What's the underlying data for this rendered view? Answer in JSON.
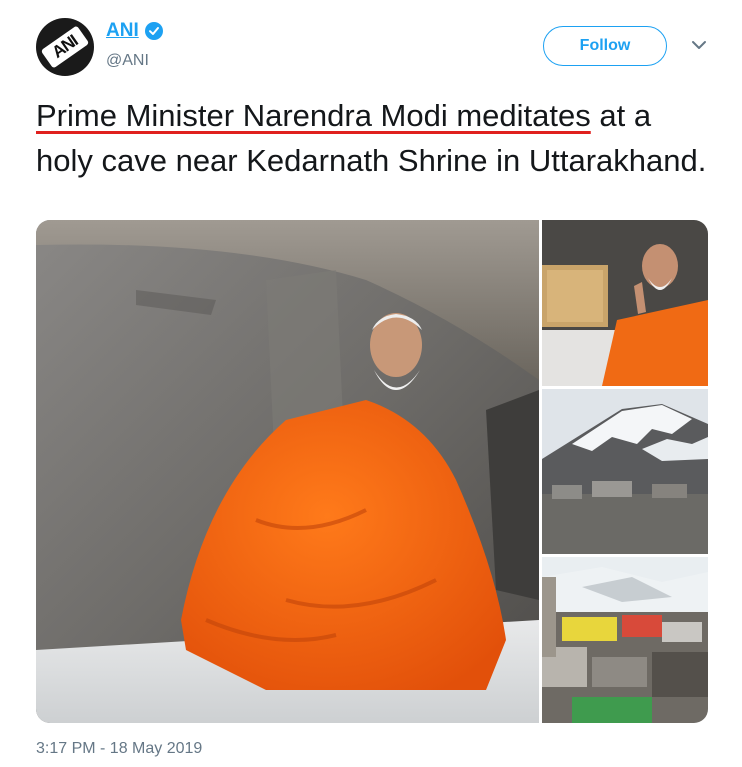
{
  "account": {
    "display_name": "ANI",
    "handle": "@ANI",
    "avatar_text": "ANI",
    "verified": true
  },
  "follow_label": "Follow",
  "tweet": {
    "text_highlighted": "Prime Minister Narendra Modi meditates",
    "text_rest": " at a holy cave near Kedarnath Shrine in Uttarakhand."
  },
  "timestamp": "3:17 PM - 18 May 2019",
  "colors": {
    "accent": "#1da1f2",
    "underline": "#e0201e",
    "text": "#14171a",
    "muted": "#657786"
  },
  "icons": [
    "verified-badge-icon",
    "chevron-down-icon"
  ]
}
